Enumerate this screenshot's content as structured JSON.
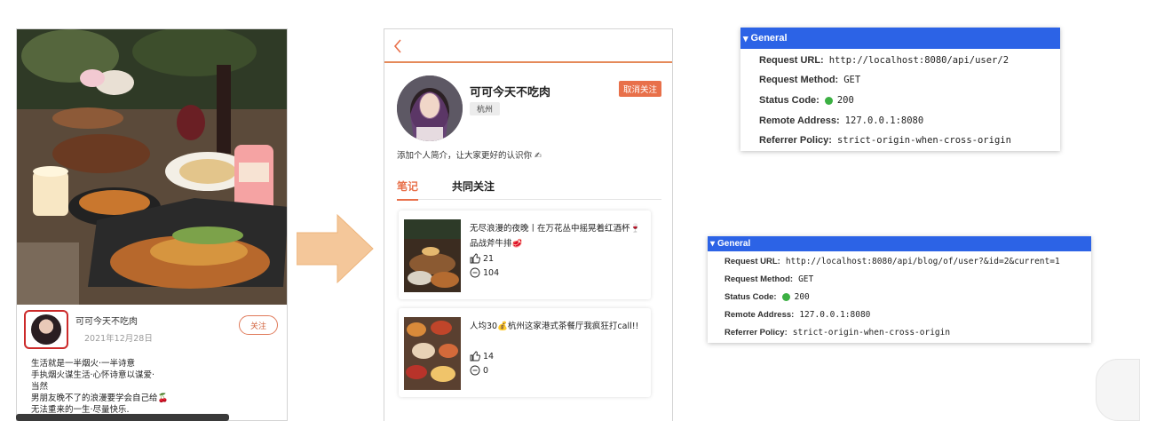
{
  "blog_detail": {
    "author_name": "可可今天不吃肉",
    "date": "2021年12月28日",
    "follow_label": "关注",
    "content_lines": [
      "生活就是一半烟火·一半诗意",
      "手执烟火谋生活·心怀诗意以谋爱·",
      "当然",
      "男朋友晚不了的浪漫要学会自己给🍒",
      "无法重来的一生·尽量快乐."
    ]
  },
  "user_page": {
    "name": "可可今天不吃肉",
    "city": "杭州",
    "unfollow_label": "取消关注",
    "intro": "添加个人简介，让大家更好的认识你 ✍",
    "tabs": [
      "笔记",
      "共同关注"
    ],
    "notes": [
      {
        "title": "无尽浪漫的夜晚丨在万花丛中摇晃着红酒杯🍷品战斧牛排🥩",
        "likes": "21",
        "comments": "104"
      },
      {
        "title": "人均30💰杭州这家港式茶餐厅我疯狂打call!!",
        "likes": "14",
        "comments": "0"
      }
    ]
  },
  "panel_1": {
    "header": "General",
    "rows": [
      {
        "key": "Request URL:",
        "value": "http://localhost:8080/api/user/2"
      },
      {
        "key": "Request Method:",
        "value": "GET"
      },
      {
        "key": "Status Code:",
        "value": "200"
      },
      {
        "key": "Remote Address:",
        "value": "127.0.0.1:8080"
      },
      {
        "key": "Referrer Policy:",
        "value": "strict-origin-when-cross-origin"
      }
    ]
  },
  "panel_2": {
    "header": "General",
    "rows": [
      {
        "key": "Request URL:",
        "value": "http://localhost:8080/api/blog/of/user?&id=2&current=1"
      },
      {
        "key": "Request Method:",
        "value": "GET"
      },
      {
        "key": "Status Code:",
        "value": "200"
      },
      {
        "key": "Remote Address:",
        "value": "127.0.0.1:8080"
      },
      {
        "key": "Referrer Policy:",
        "value": "strict-origin-when-cross-origin"
      }
    ]
  },
  "colors": {
    "accent": "#e8704a",
    "devtools_header": "#2c63e6",
    "status_ok": "#3cb043",
    "arrow": "#f4c79a"
  },
  "icons": [
    "back-chevron-icon",
    "like-thumb-icon",
    "comment-bubble-icon",
    "status-dot-icon",
    "collapse-triangle-icon",
    "right-arrow-icon"
  ]
}
